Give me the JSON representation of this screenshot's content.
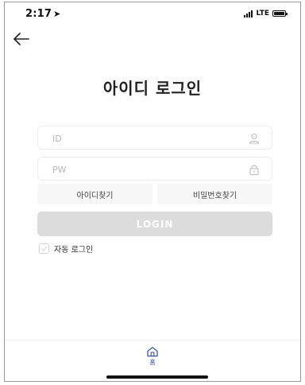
{
  "status_bar": {
    "time": "2:17",
    "location_icon": "location-arrow-icon",
    "network": "LTE",
    "signal_icon": "signal-bars-icon",
    "battery_icon": "battery-icon"
  },
  "header": {
    "back_icon": "arrow-left-icon"
  },
  "main": {
    "title": "아이디 로그인",
    "id_field": {
      "placeholder": "ID",
      "value": "",
      "icon": "user-icon"
    },
    "pw_field": {
      "placeholder": "PW",
      "value": "",
      "icon": "lock-icon"
    },
    "find_id_label": "아이디찾기",
    "find_pw_label": "비밀번호찾기",
    "login_label": "LOGIN",
    "auto_login_label": "자동 로그인",
    "auto_login_checked": false
  },
  "tab_bar": {
    "home_label": "홈",
    "home_icon": "home-icon"
  },
  "colors": {
    "login_button_bg": "#dcdcdc",
    "field_border": "#eeeeee",
    "find_button_bg": "#f7f7f7",
    "tab_active": "#3a56a8"
  }
}
